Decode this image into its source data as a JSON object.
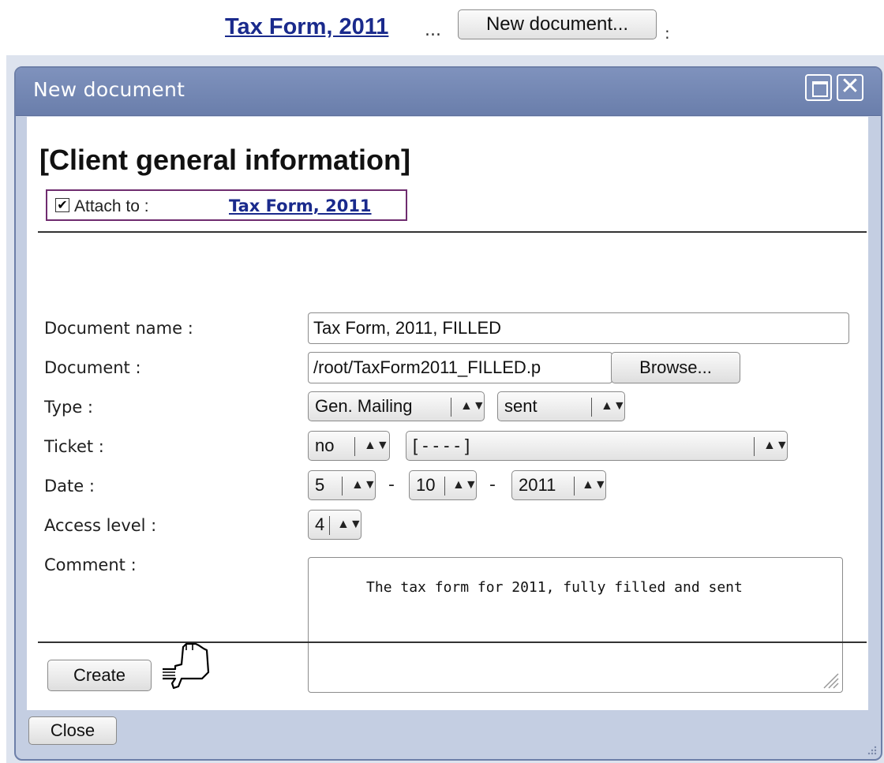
{
  "top": {
    "link": "Tax Form, 2011",
    "ellipsis": "...",
    "button": "New document...",
    "colon": ":"
  },
  "dialog": {
    "title": "New document",
    "maximize_icon": "maximize-icon",
    "close_icon": "close-icon",
    "close_glyph": "✕",
    "heading": "[Client general information]",
    "attach": {
      "checked": true,
      "check_glyph": "✔",
      "label": "Attach to :",
      "link": "Tax Form, 2011"
    },
    "fields": {
      "document_name": {
        "label": "Document name :",
        "value": "Tax Form, 2011, FILLED"
      },
      "document": {
        "label": "Document :",
        "value": "/root/TaxForm2011_FILLED.p",
        "browse": "Browse..."
      },
      "type": {
        "label": "Type :",
        "value1": "Gen. Mailing",
        "value2": "sent"
      },
      "ticket": {
        "label": "Ticket :",
        "value1": "no",
        "value2": "[ - - - - ]"
      },
      "date": {
        "label": "Date :",
        "day": "5",
        "month": "10",
        "year": "2011",
        "separator": "-"
      },
      "access_level": {
        "label": "Access level :",
        "value": "4"
      },
      "comment": {
        "label": "Comment :",
        "value": "The tax form for 2011, fully filled and sent"
      }
    },
    "create_button": "Create",
    "close_button": "Close",
    "pointer_icon": "pointing-hand-icon"
  },
  "colors": {
    "link": "#1a2a8c",
    "titlebar": "#7386b3",
    "dialog_bg": "#c4cee2",
    "attach_border": "#6f2c6f"
  }
}
